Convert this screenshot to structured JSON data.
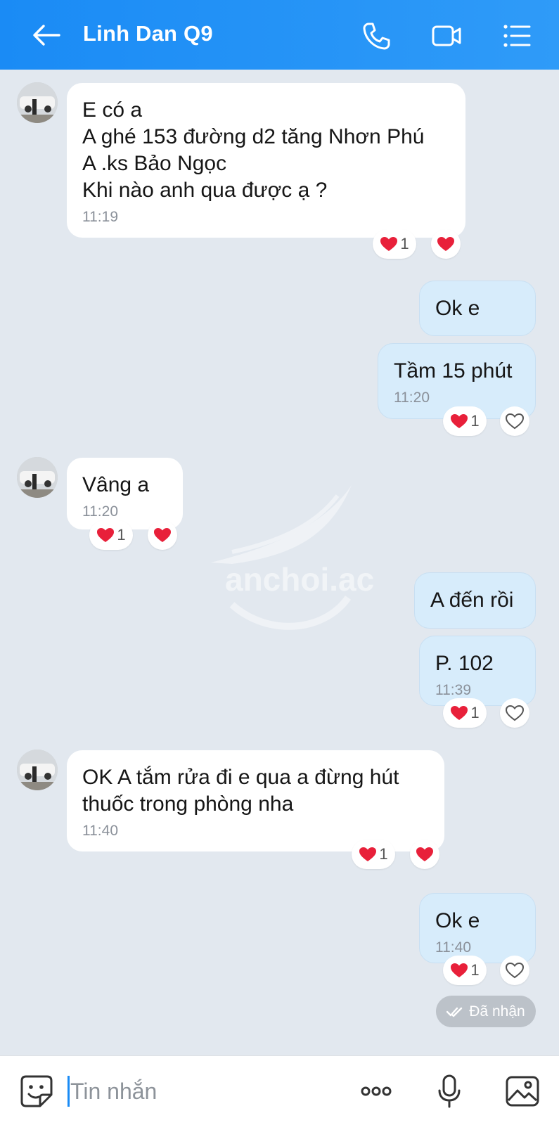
{
  "header": {
    "title": "Linh Dan Q9",
    "back_icon": "arrow-left-icon",
    "call_icon": "phone-icon",
    "video_icon": "video-camera-icon",
    "menu_icon": "list-menu-icon",
    "color": "#1a8bf5"
  },
  "messages": [
    {
      "dir": "in",
      "lines": [
        "E có a",
        "A ghé 153 đường d2 tăng Nhơn Phú",
        "A .ks Bảo Ngọc",
        "Khi nào anh qua được ạ ?"
      ],
      "time": "11:19",
      "reaction_count": "1"
    },
    {
      "dir": "out",
      "lines": [
        "Ok e"
      ],
      "time": ""
    },
    {
      "dir": "out",
      "lines": [
        "Tầm 15 phút"
      ],
      "time": "11:20",
      "reaction_count": "1"
    },
    {
      "dir": "in",
      "lines": [
        "Vâng a"
      ],
      "time": "11:20",
      "reaction_count": "1"
    },
    {
      "dir": "out",
      "lines": [
        "A đến rồi"
      ],
      "time": ""
    },
    {
      "dir": "out",
      "lines": [
        "P. 102"
      ],
      "time": "11:39",
      "reaction_count": "1"
    },
    {
      "dir": "in",
      "lines": [
        "OK A tắm rửa đi e qua a đừng hút",
        "thuốc trong phòng nha"
      ],
      "time": "11:40",
      "reaction_count": "1"
    },
    {
      "dir": "out",
      "lines": [
        "Ok e"
      ],
      "time": "11:40",
      "reaction_count": "1"
    }
  ],
  "status": {
    "seen_label": "Đã nhận"
  },
  "watermark": {
    "text": "anchoi.ac"
  },
  "composer": {
    "placeholder": "Tin nhắn",
    "sticker_icon": "emoji-sticker-icon",
    "more_icon": "more-dots-icon",
    "mic_icon": "microphone-icon",
    "image_icon": "image-gallery-icon"
  },
  "colors": {
    "incoming_bubble": "#ffffff",
    "outgoing_bubble": "#d7ecfb",
    "background": "#e2e8ef",
    "heart": "#e8203a"
  }
}
